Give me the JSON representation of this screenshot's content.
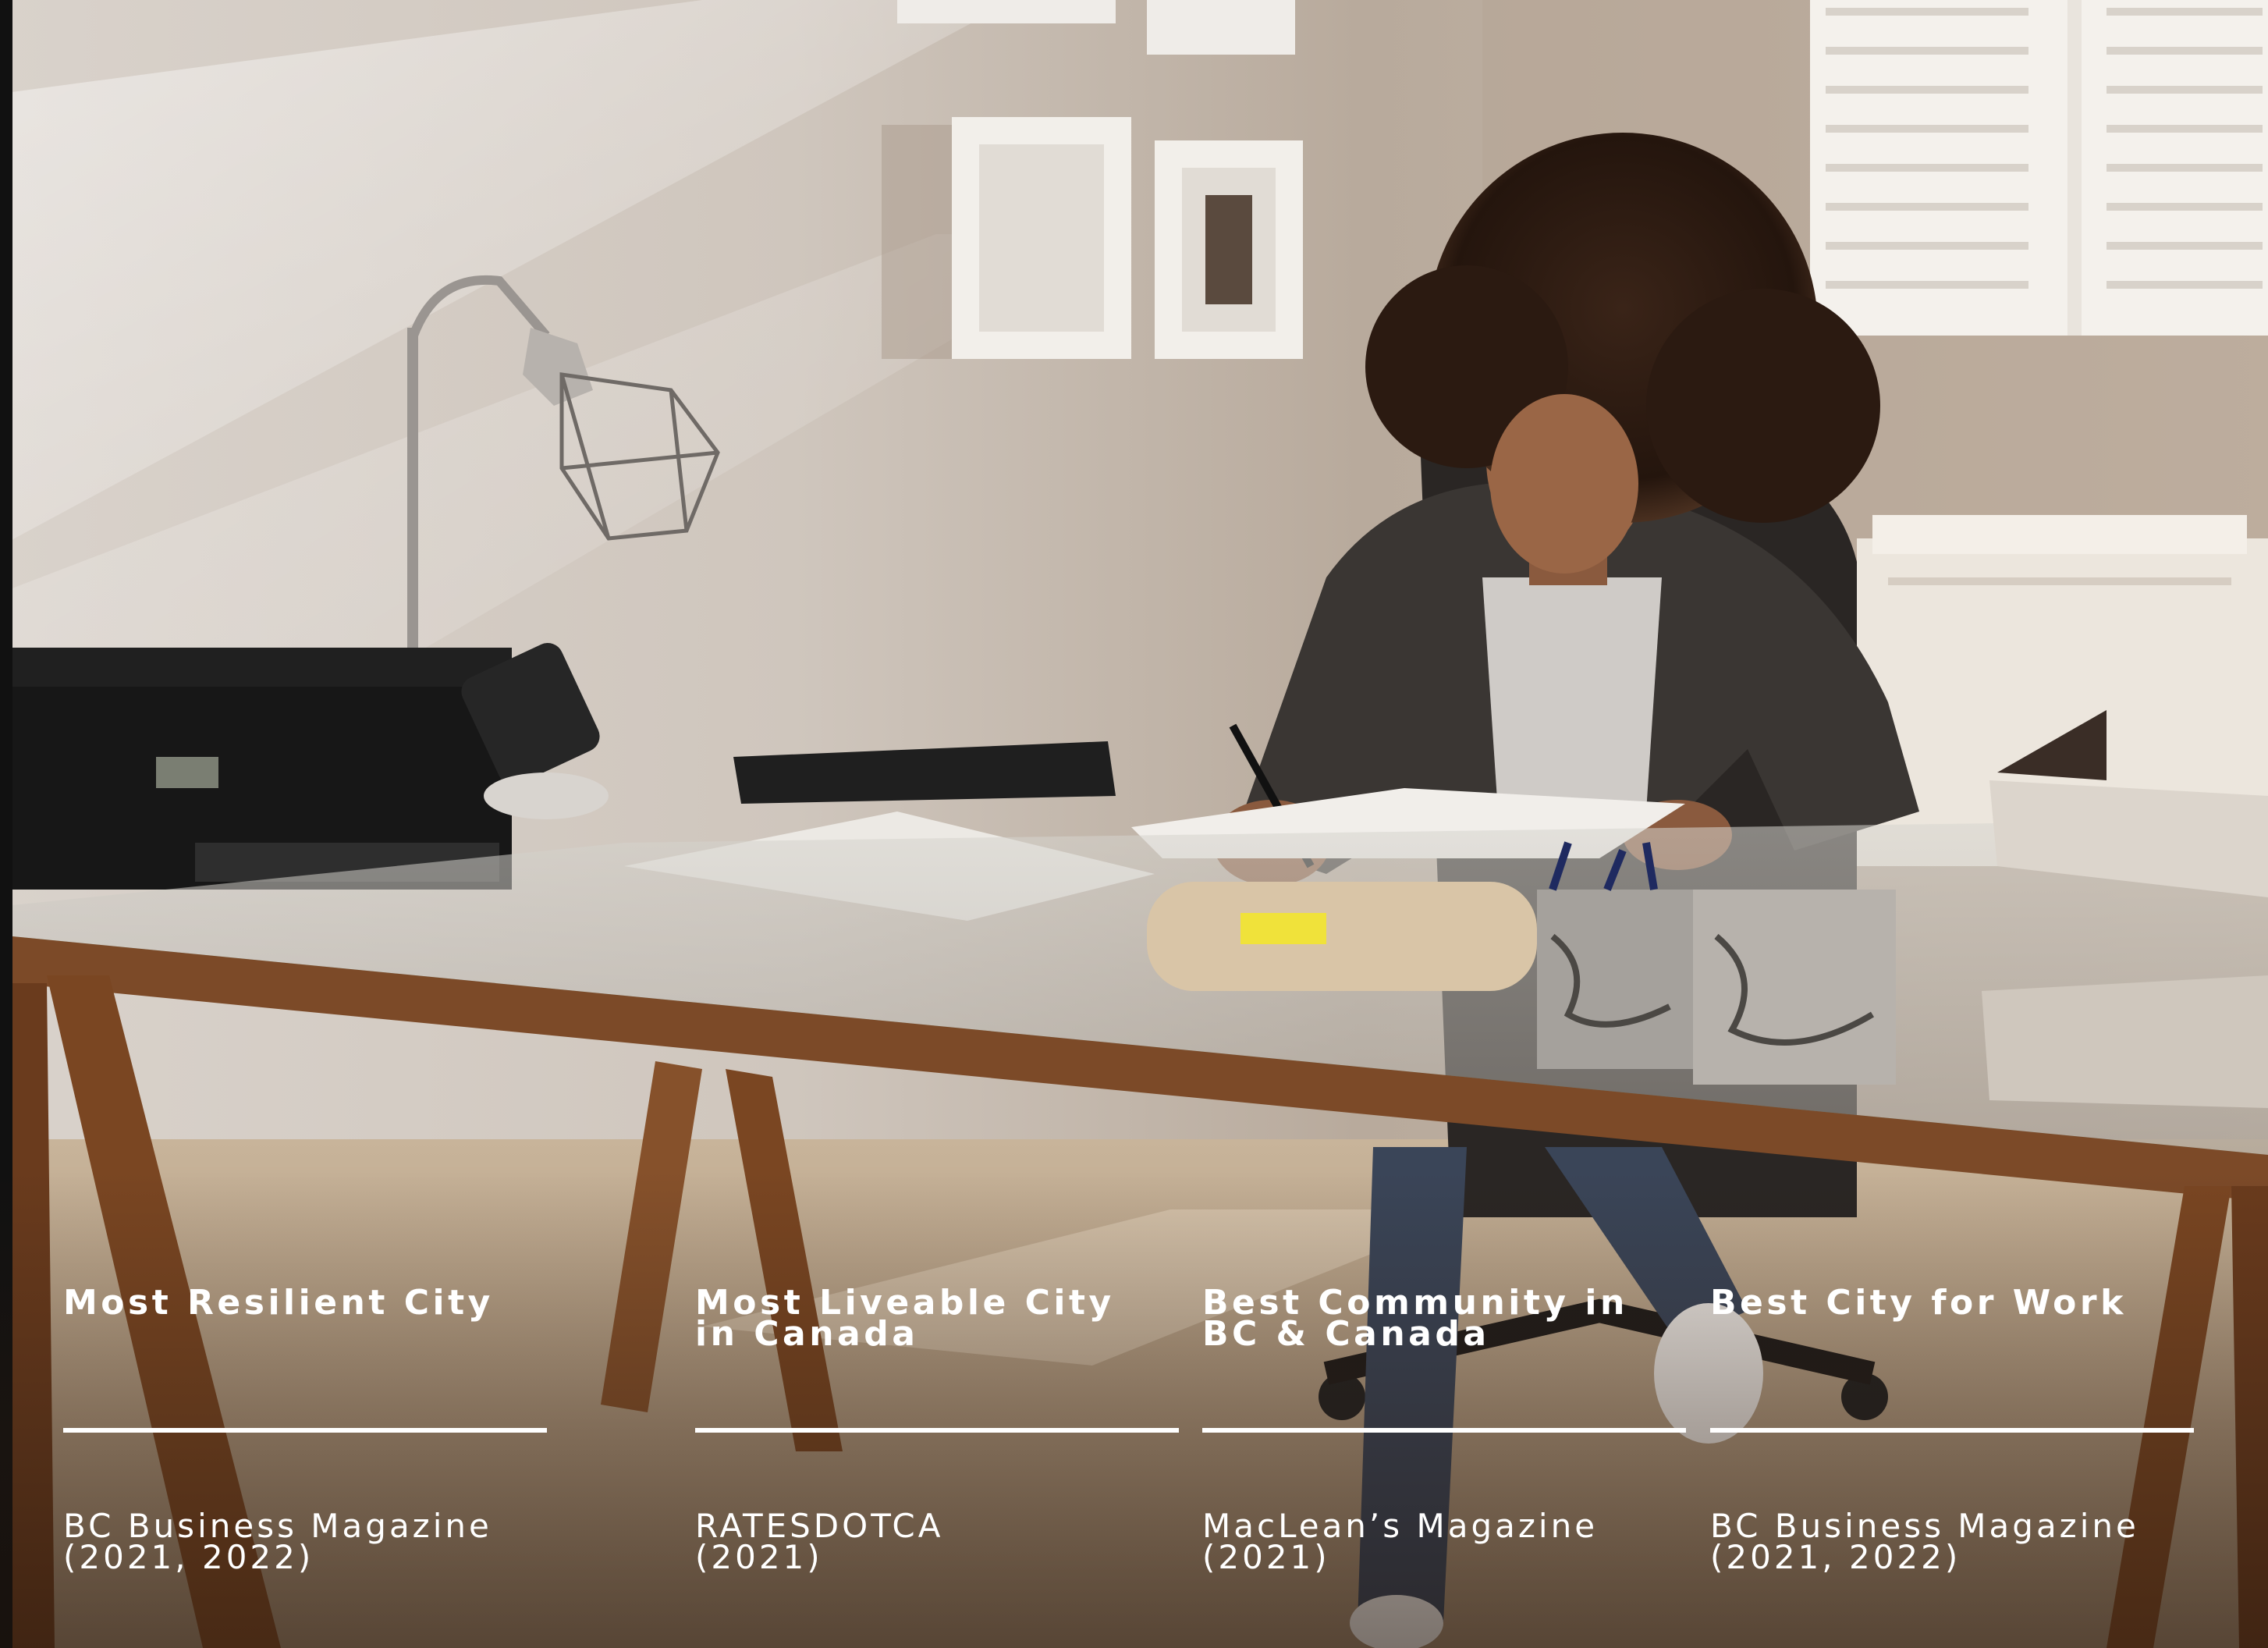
{
  "awards": [
    {
      "title": "Most Resilient City",
      "source": "BC Business Magazine\n(2021, 2022)"
    },
    {
      "title": "Most Liveable City\nin Canada",
      "source": "RATESDOTCA\n(2021)"
    },
    {
      "title": "Best Community in\nBC & Canada",
      "source": "MacLean’s Magazine\n(2021)"
    },
    {
      "title": "Best City for Work",
      "source": "BC Business Magazine\n(2021, 2022)"
    }
  ]
}
